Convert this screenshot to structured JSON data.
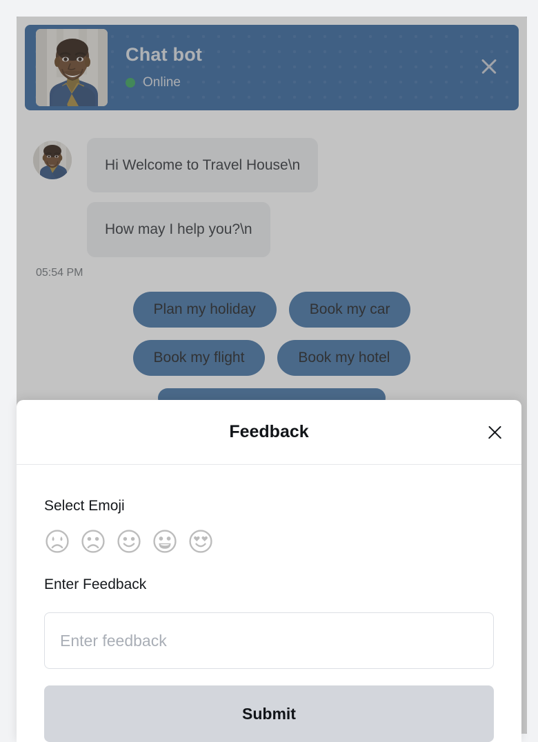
{
  "header": {
    "bot_name": "Chat bot",
    "status": "Online",
    "close_icon": "close-icon",
    "avatar_alt": "bot-avatar",
    "bg_color": "#33659d",
    "status_color": "#38a35a"
  },
  "conversation": {
    "messages": [
      {
        "text": "Hi Welcome to Travel House\\n",
        "has_avatar": true
      },
      {
        "text": "How may I help you?\\n",
        "has_avatar": false
      }
    ],
    "timestamp": "05:54 PM",
    "bubble_color": "#eceef0"
  },
  "quick_replies": {
    "accent_color": "#4272a4",
    "items": [
      {
        "label": "Plan my holiday",
        "wide": false
      },
      {
        "label": "Book my car",
        "wide": false
      },
      {
        "label": "Book my flight",
        "wide": false
      },
      {
        "label": "Book my hotel",
        "wide": false
      },
      {
        "label": "",
        "wide": true
      }
    ]
  },
  "feedback_modal": {
    "title": "Feedback",
    "close_icon": "close-icon",
    "emoji_label": "Select Emoji",
    "emojis": [
      {
        "name": "crying-face-emoji"
      },
      {
        "name": "sad-face-emoji"
      },
      {
        "name": "slightly-smiling-face-emoji"
      },
      {
        "name": "grinning-face-emoji"
      },
      {
        "name": "heart-eyes-face-emoji"
      }
    ],
    "input_label": "Enter Feedback",
    "input_placeholder": "Enter feedback",
    "input_value": "",
    "submit_label": "Submit",
    "submit_color": "#d3d6dc"
  }
}
